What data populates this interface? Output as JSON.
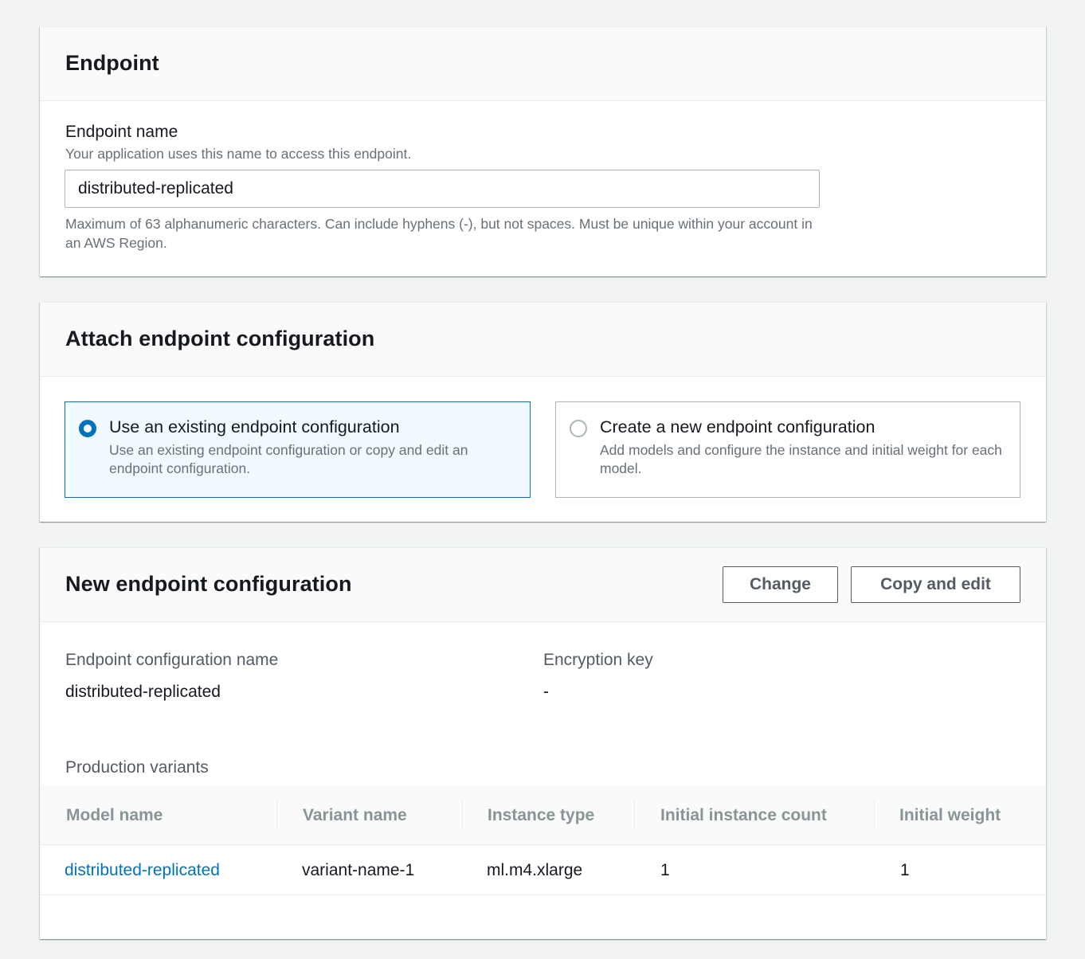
{
  "endpoint_panel": {
    "title": "Endpoint",
    "name_label": "Endpoint name",
    "name_description": "Your application uses this name to access this endpoint.",
    "name_value": "distributed-replicated",
    "name_constraint": "Maximum of 63 alphanumeric characters. Can include hyphens (-), but not spaces. Must be unique within your account in an AWS Region."
  },
  "attach_panel": {
    "title": "Attach endpoint configuration",
    "options": [
      {
        "title": "Use an existing endpoint configuration",
        "description": "Use an existing endpoint configuration or copy and edit an endpoint configuration.",
        "selected": true
      },
      {
        "title": "Create a new endpoint configuration",
        "description": "Add models and configure the instance and initial weight for each model.",
        "selected": false
      }
    ]
  },
  "config_panel": {
    "title": "New endpoint configuration",
    "change_label": "Change",
    "copy_edit_label": "Copy and edit",
    "config_name_label": "Endpoint configuration name",
    "config_name_value": "distributed-replicated",
    "encryption_label": "Encryption key",
    "encryption_value": "-",
    "variants_label": "Production variants",
    "table": {
      "columns": [
        "Model name",
        "Variant name",
        "Instance type",
        "Initial instance count",
        "Initial weight"
      ],
      "rows": [
        [
          "distributed-replicated",
          "variant-name-1",
          "ml.m4.xlarge",
          "1",
          "1"
        ]
      ]
    }
  },
  "colors": {
    "link": "#0073bb",
    "selected_border": "#0073bb",
    "selected_bg": "#f1faff",
    "page_bg": "#f2f3f3"
  }
}
